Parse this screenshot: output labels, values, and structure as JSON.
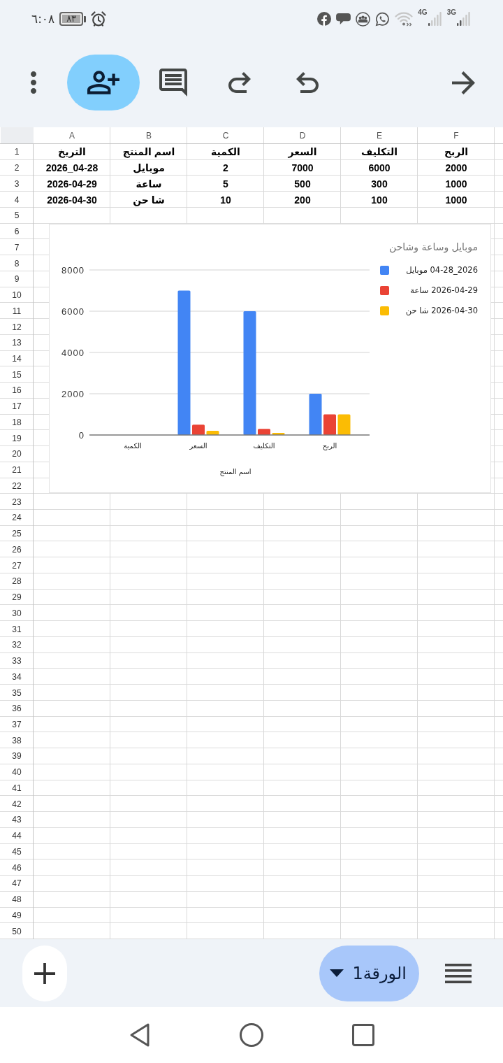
{
  "status_bar": {
    "time": "٦:٠٨",
    "battery": "٨٣",
    "network_labels": [
      "3G",
      "4G"
    ]
  },
  "sheet": {
    "columns": [
      "F",
      "E",
      "D",
      "C",
      "B",
      "A"
    ],
    "row_numbers": [
      "1",
      "2",
      "3",
      "4",
      "5",
      "6",
      "7",
      "8",
      "9",
      "10",
      "11",
      "12",
      "13",
      "14",
      "15",
      "16",
      "17",
      "18",
      "19",
      "20",
      "21",
      "22",
      "23",
      "24",
      "25",
      "26",
      "27",
      "28",
      "29",
      "30",
      "31",
      "32",
      "33",
      "34",
      "35",
      "36",
      "37",
      "38",
      "39",
      "40",
      "41",
      "42",
      "43",
      "44",
      "45",
      "46",
      "47",
      "48",
      "49",
      "50"
    ],
    "rows": [
      [
        "الربح",
        "التكليف",
        "السعر",
        "الكمية",
        "اسم المنتج",
        "التريخ"
      ],
      [
        "2000",
        "6000",
        "7000",
        "2",
        "موبايل",
        "2026_04-28"
      ],
      [
        "1000",
        "300",
        "500",
        "5",
        "ساعة",
        "2026-04-29"
      ],
      [
        "1000",
        "100",
        "200",
        "10",
        "شا حن",
        "2026-04-30"
      ]
    ]
  },
  "chart": {
    "chart_data": {
      "type": "bar",
      "title": "موبايل وساعة وشاحن",
      "xlabel": "اسم المنتج",
      "categories": [
        "الكمية",
        "السعر",
        "التكليف",
        "الربح"
      ],
      "series": [
        {
          "name": "2026_04-28 موبايل",
          "color": "#4285f4",
          "values": [
            0,
            7000,
            6000,
            2000
          ]
        },
        {
          "name": "2026-04-29 ساعة",
          "color": "#ea4335",
          "values": [
            0,
            500,
            300,
            1000
          ]
        },
        {
          "name": "2026-04-30 شا حن",
          "color": "#fbbc04",
          "values": [
            0,
            200,
            100,
            1000
          ]
        }
      ],
      "ylim": [
        0,
        8000
      ],
      "yticks": [
        0,
        2000,
        4000,
        6000,
        8000
      ],
      "grid": true,
      "legend": "right"
    }
  },
  "sheet_tabs": [
    {
      "label": "الورقة1",
      "selected": true
    }
  ]
}
